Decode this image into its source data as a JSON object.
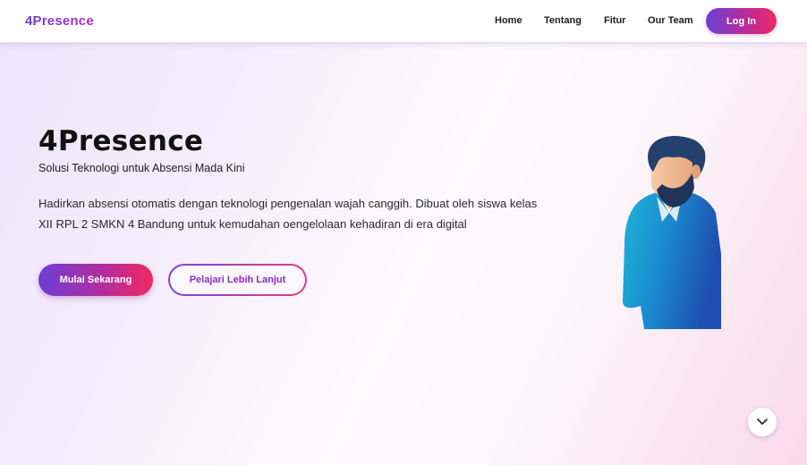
{
  "nav": {
    "brand": "4Presence",
    "links": [
      "Home",
      "Tentang",
      "Fitur",
      "Our Team"
    ],
    "login_label": "Log In"
  },
  "hero": {
    "title": "4Presence",
    "subtitle": "Solusi Teknologi untuk Absensi Mada Kini",
    "description": "Hadirkan absensi otomatis dengan teknologi pengenalan wajah canggih. Dibuat oleh siswa kelas XII RPL 2 SMKN 4 Bandung untuk kemudahan oengelolaan kehadiran di era digital",
    "primary_button": "Mulai Sekarang",
    "secondary_button": "Pelajari Lebih Lanjut"
  },
  "icons": {
    "illustration": "person-illustration-icon",
    "scroll": "chevron-down-icon"
  },
  "colors": {
    "accent_purple": "#6a3fd6",
    "accent_pink": "#ee2b63",
    "outline_text": "#8a2fb8"
  }
}
